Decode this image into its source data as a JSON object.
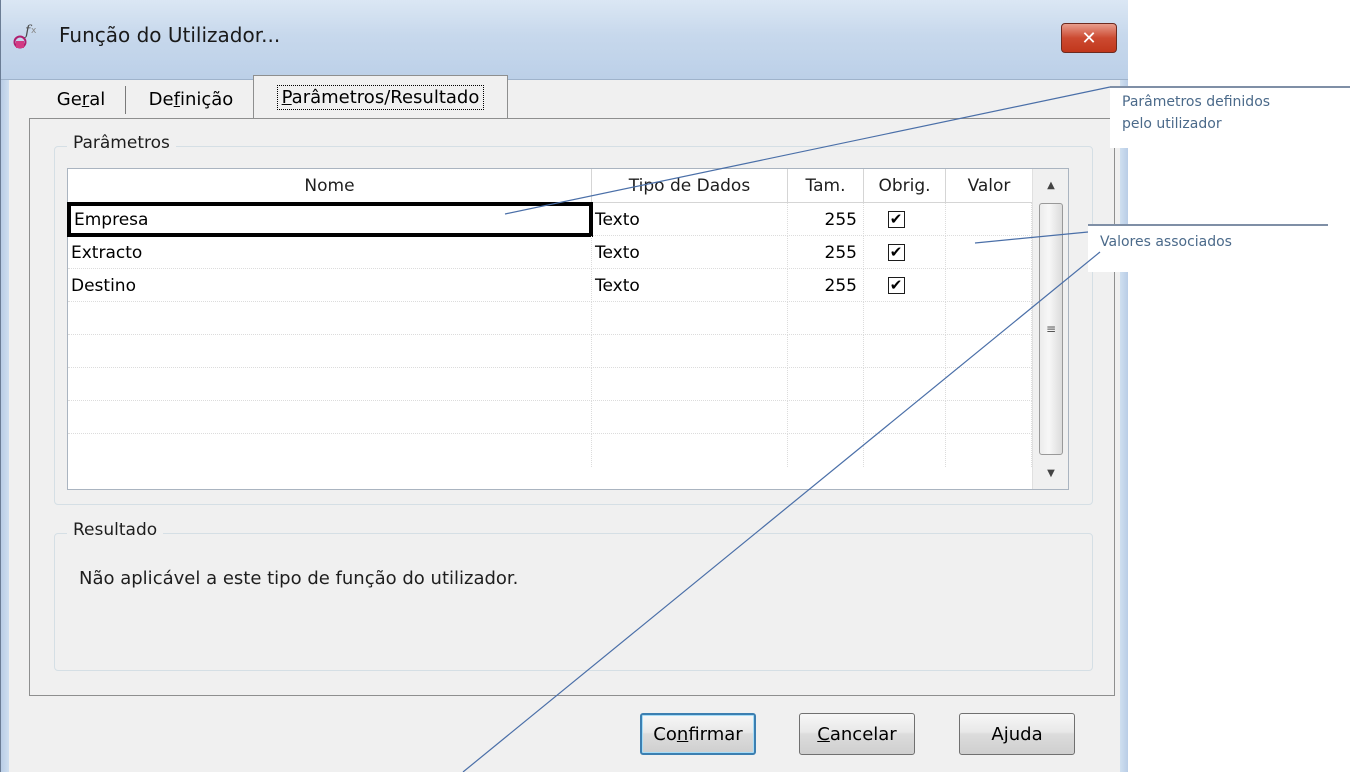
{
  "window": {
    "title": "Função do Utilizador...",
    "close_label": "✕"
  },
  "tabs": [
    {
      "label_prefix": "Ge",
      "label_ul": "r",
      "label_suffix": "al"
    },
    {
      "label_prefix": "De",
      "label_ul": "f",
      "label_suffix": "inição"
    },
    {
      "label_prefix": "",
      "label_ul": "P",
      "label_suffix": "arâmetros/Resultado",
      "active": true
    }
  ],
  "parametros": {
    "group_title": "Parâmetros",
    "columns": [
      "Nome",
      "Tipo de Dados",
      "Tam.",
      "Obrig.",
      "Valor"
    ],
    "rows": [
      {
        "nome": "Empresa",
        "tipo": "Texto",
        "tam": "255",
        "obrig": "✔",
        "valor": ""
      },
      {
        "nome": "Extracto",
        "tipo": "Texto",
        "tam": "255",
        "obrig": "✔",
        "valor": ""
      },
      {
        "nome": "Destino",
        "tipo": "Texto",
        "tam": "255",
        "obrig": "✔",
        "valor": ""
      }
    ],
    "scroll_up": "▲",
    "scroll_down": "▼",
    "scroll_grip": "≡"
  },
  "resultado": {
    "group_title": "Resultado",
    "text": "Não aplicável a este tipo de função do utilizador."
  },
  "buttons": {
    "confirm": {
      "prefix": "Co",
      "ul": "n",
      "suffix": "firmar"
    },
    "cancel": {
      "prefix": "",
      "ul": "C",
      "suffix": "ancelar"
    },
    "help": {
      "prefix": "A",
      "ul": "j",
      "suffix": "uda"
    }
  },
  "callouts": {
    "params": {
      "line1": "Parâmetros definidos",
      "line2": "pelo utilizador"
    },
    "values": {
      "text": "Valores  associados"
    }
  }
}
